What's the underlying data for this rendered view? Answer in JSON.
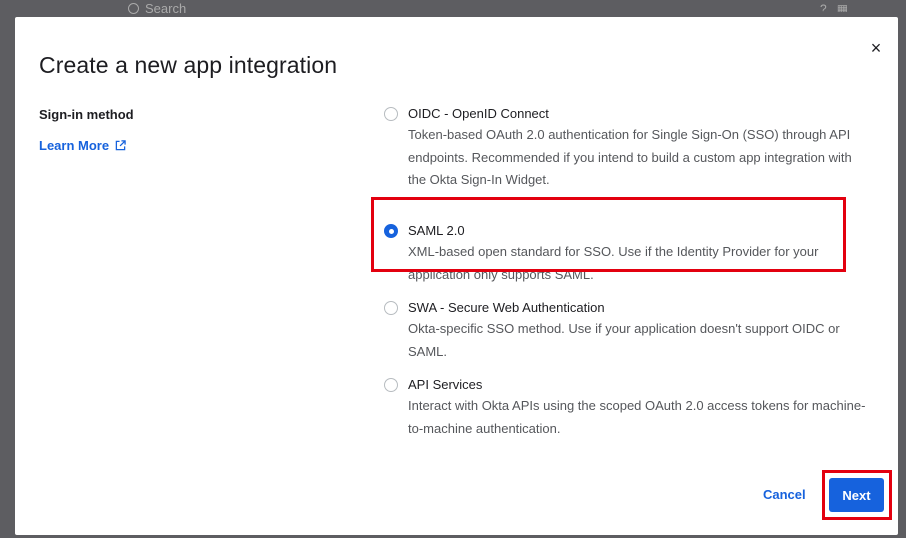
{
  "background": {
    "search_text": "Search"
  },
  "modal": {
    "title": "Create a new app integration",
    "close_glyph": "×",
    "section_label": "Sign-in method",
    "learn_more": "Learn More",
    "options": [
      {
        "label": "OIDC - OpenID Connect",
        "description": "Token-based OAuth 2.0 authentication for Single Sign-On (SSO) through API endpoints. Recommended if you intend to build a custom app integration with the Okta Sign-In Widget.",
        "selected": false
      },
      {
        "label": "SAML 2.0",
        "description": "XML-based open standard for SSO. Use if the Identity Provider for your application only supports SAML.",
        "selected": true
      },
      {
        "label": "SWA - Secure Web Authentication",
        "description": "Okta-specific SSO method. Use if your application doesn't support OIDC or SAML.",
        "selected": false
      },
      {
        "label": "API Services",
        "description": "Interact with Okta APIs using the scoped OAuth 2.0 access tokens for machine-to-machine authentication.",
        "selected": false
      }
    ],
    "cancel_label": "Cancel",
    "next_label": "Next"
  },
  "colors": {
    "accent": "#1662dd",
    "highlight": "#e3000f"
  }
}
